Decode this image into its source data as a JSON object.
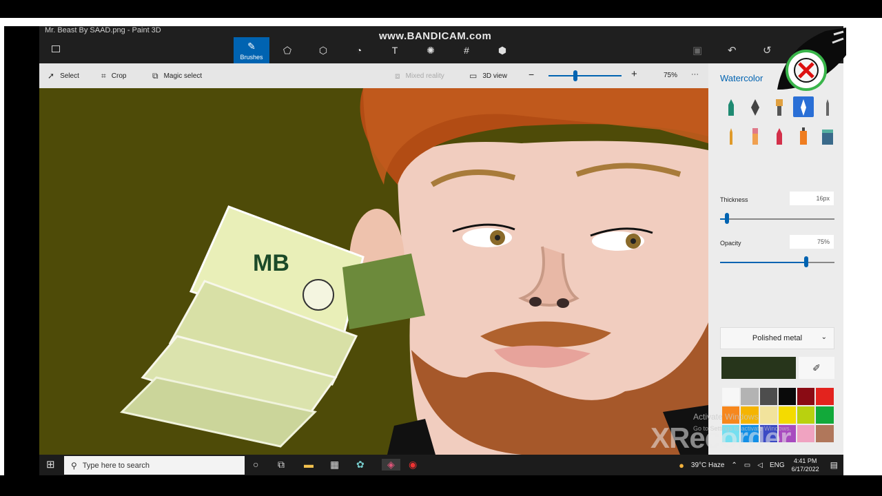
{
  "window": {
    "title": "Mr. Beast By SAAD.png  - Paint 3D",
    "watermark": "www.BANDICAM.com"
  },
  "toolbar": {
    "active_tool_label": "Brushes"
  },
  "commandbar": {
    "select": "Select",
    "crop": "Crop",
    "magic_select": "Magic select",
    "mixed_reality": "Mixed reality",
    "view3d": "3D view",
    "zoom": "75%",
    "more": "···"
  },
  "panel": {
    "title": "Watercolor",
    "thickness_label": "Thickness",
    "thickness_value": "16px",
    "thickness_level": 0.06,
    "opacity_label": "Opacity",
    "opacity_value": "75%",
    "opacity_level": 0.75,
    "texture": "Polished metal",
    "current_color": "#27351b",
    "palette": [
      "#f7f7f7",
      "#b3b3b3",
      "#4d4d4d",
      "#0a0a0a",
      "#8a0b14",
      "#e3231e",
      "#f7871d",
      "#f5b400",
      "#f2e39c",
      "#f4db00",
      "#b9d10f",
      "#12a93a",
      "#75dff0",
      "#138fe6",
      "#3b4ac4",
      "#a84bbf",
      "#f0a3c1",
      "#b0775b"
    ]
  },
  "taskbar": {
    "search_placeholder": "Type here to search",
    "weather": "39°C  Haze",
    "lang": "ENG",
    "time": "4:41 PM",
    "date": "6/17/2022"
  },
  "overlay": {
    "activate_title": "Activate Windows",
    "activate_sub": "Go to Settings to activate Windows.",
    "recorder": "XRecorder"
  }
}
